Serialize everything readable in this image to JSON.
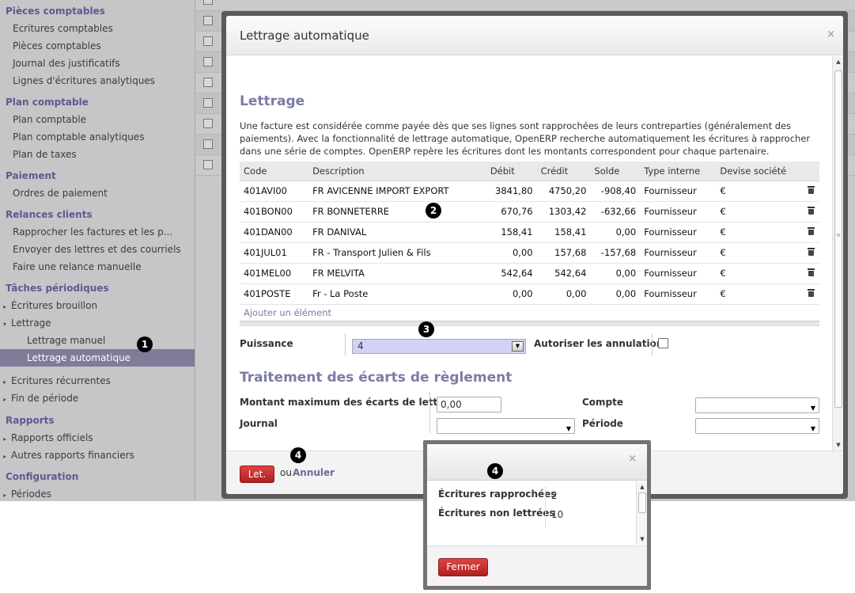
{
  "sidebar": {
    "sections": [
      {
        "title": "Pièces comptables",
        "items": [
          "Ecritures comptables",
          "Pièces comptables",
          "Journal des justificatifs",
          "Lignes d'écritures analytiques"
        ]
      },
      {
        "title": "Plan comptable",
        "items": [
          "Plan comptable",
          "Plan comptable analytiques",
          "Plan de taxes"
        ]
      },
      {
        "title": "Paiement",
        "items": [
          "Ordres de paiement"
        ]
      },
      {
        "title": "Relances clients",
        "items": [
          "Rapprocher les factures et les p...",
          "Envoyer des lettres et des courriels",
          "Faire une relance manuelle"
        ]
      }
    ],
    "taches": {
      "title": "Tâches périodiques",
      "brouillon": "Écritures brouillon",
      "lettrage": "Lettrage",
      "lettrage_manuel": "Lettrage manuel",
      "lettrage_auto": "Lettrage automatique",
      "recurrentes": "Ecritures récurrentes",
      "fin_periode": "Fin de période"
    },
    "rapports": {
      "title": "Rapports",
      "officiels": "Rapports officiels",
      "autres": "Autres rapports financiers"
    },
    "config": {
      "title": "Configuration",
      "periodes": "Périodes"
    }
  },
  "modal": {
    "title": "Lettrage automatique",
    "close": "×",
    "section_lettrage": "Lettrage",
    "intro": "Une facture est considérée comme payée dès que ses lignes sont rapprochées de leurs contreparties (généralement des paiements). Avec la fonctionnalité de lettrage automatique, OpenERP recherche automatiquement les écritures à rapprocher dans une série de comptes. OpenERP repère les écritures dont les montants correspondent pour chaque partenaire.",
    "table": {
      "headers": [
        "Code",
        "Description",
        "Débit",
        "Crédit",
        "Solde",
        "Type interne",
        "Devise société"
      ],
      "rows": [
        [
          "401AVI00",
          "FR AVICENNE IMPORT EXPORT",
          "3841,80",
          "4750,20",
          "-908,40",
          "Fournisseur",
          "€"
        ],
        [
          "401BON00",
          "FR BONNETERRE",
          "670,76",
          "1303,42",
          "-632,66",
          "Fournisseur",
          "€"
        ],
        [
          "401DAN00",
          "FR DANIVAL",
          "158,41",
          "158,41",
          "0,00",
          "Fournisseur",
          "€"
        ],
        [
          "401JUL01",
          "FR - Transport Julien & Fils",
          "0,00",
          "157,68",
          "-157,68",
          "Fournisseur",
          "€"
        ],
        [
          "401MEL00",
          "FR MELVITA",
          "542,64",
          "542,64",
          "0,00",
          "Fournisseur",
          "€"
        ],
        [
          "401POSTE",
          "Fr - La Poste",
          "0,00",
          "0,00",
          "0,00",
          "Fournisseur",
          "€"
        ]
      ]
    },
    "add_item": "Ajouter un élément",
    "puissance_label": "Puissance",
    "puissance_value": "4",
    "autoriser_label": "Autoriser les annulations",
    "section_ecarts": "Traitement des écarts de règlement",
    "montant_label": "Montant maximum des écarts de lettrage",
    "montant_value": "0,00",
    "journal_label": "Journal",
    "compte_label": "Compte",
    "periode_label": "Période",
    "btn_let": "Let.",
    "or_text": "ou",
    "cancel": "Annuler"
  },
  "result": {
    "close": "×",
    "rapprochees_label": "Écritures rapprochées",
    "rapprochees_value": "2",
    "non_lettrees_label": "Écritures non lettrées",
    "non_lettrees_value": "10",
    "btn_fermer": "Fermer"
  },
  "markers": {
    "m1": "1",
    "m2": "2",
    "m3": "3",
    "m4a": "4",
    "m4b": "4"
  }
}
